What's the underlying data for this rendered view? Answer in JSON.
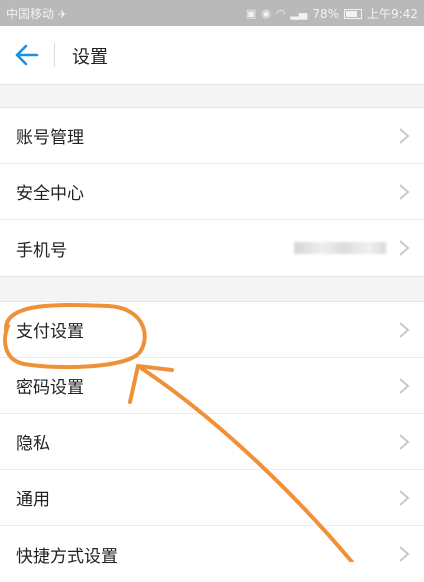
{
  "status_bar": {
    "carrier": "中国移动",
    "battery_percent": "78%",
    "time": "上午9:42"
  },
  "nav": {
    "title": "设置"
  },
  "groups": [
    {
      "items": [
        {
          "label": "账号管理"
        },
        {
          "label": "安全中心"
        },
        {
          "label": "手机号"
        }
      ]
    },
    {
      "items": [
        {
          "label": "支付设置"
        },
        {
          "label": "密码设置"
        },
        {
          "label": "隐私"
        },
        {
          "label": "通用"
        },
        {
          "label": "快捷方式设置"
        }
      ]
    }
  ],
  "colors": {
    "back_arrow": "#1e8fe1",
    "annotation": "#f0913a",
    "chevron": "#c8c8c8"
  }
}
